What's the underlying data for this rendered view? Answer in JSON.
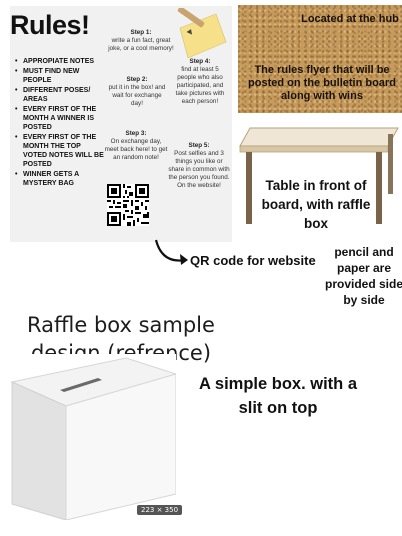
{
  "flyer": {
    "title": "Rules!",
    "bullets": [
      "APPROPIATE NOTES",
      "MUST FIND NEW PEOPLE",
      "DIFFERENT POSES/ AREAS",
      "EVERY FIRST OF THE MONTH A WINNER IS POSTED",
      "EVERY FIRST OF THE MONTH THE TOP VOTED NOTES WILL BE POSTED",
      "WINNER GETS A MYSTERY BAG"
    ],
    "steps": [
      {
        "title": "Step 1:",
        "text": "write a fun fact, great joke, or a cool memory!"
      },
      {
        "title": "Step 2:",
        "text": "put it in the box! and wait for exchange day!"
      },
      {
        "title": "Step 3:",
        "text": "On exchange day, meet back here! to get an random note!"
      },
      {
        "title": "Step 4:",
        "text": "find at least 5 people who also participated, and take pictures with each person!"
      },
      {
        "title": "Step 5:",
        "text": "Post selfies and 3 things you like or share in common with the person you found. On the website!"
      }
    ]
  },
  "bulletin": {
    "location": "Located at the hub",
    "description": "The rules flyer that will be posted on the bulletin board along with wins"
  },
  "table_note": "Table in front of board, with raffle box",
  "qr_note": "QR code for website",
  "supplies_note": "pencil and paper are provided side by side",
  "raffle_heading": "Raffle box sample design (refrence)",
  "box_note": "A simple box. with a slit on top",
  "image_size": "223 × 350",
  "colors": {
    "cork": "#c69a5b",
    "flyer_bg": "#f1f1f1",
    "sticky_note": "#f7e08a"
  }
}
